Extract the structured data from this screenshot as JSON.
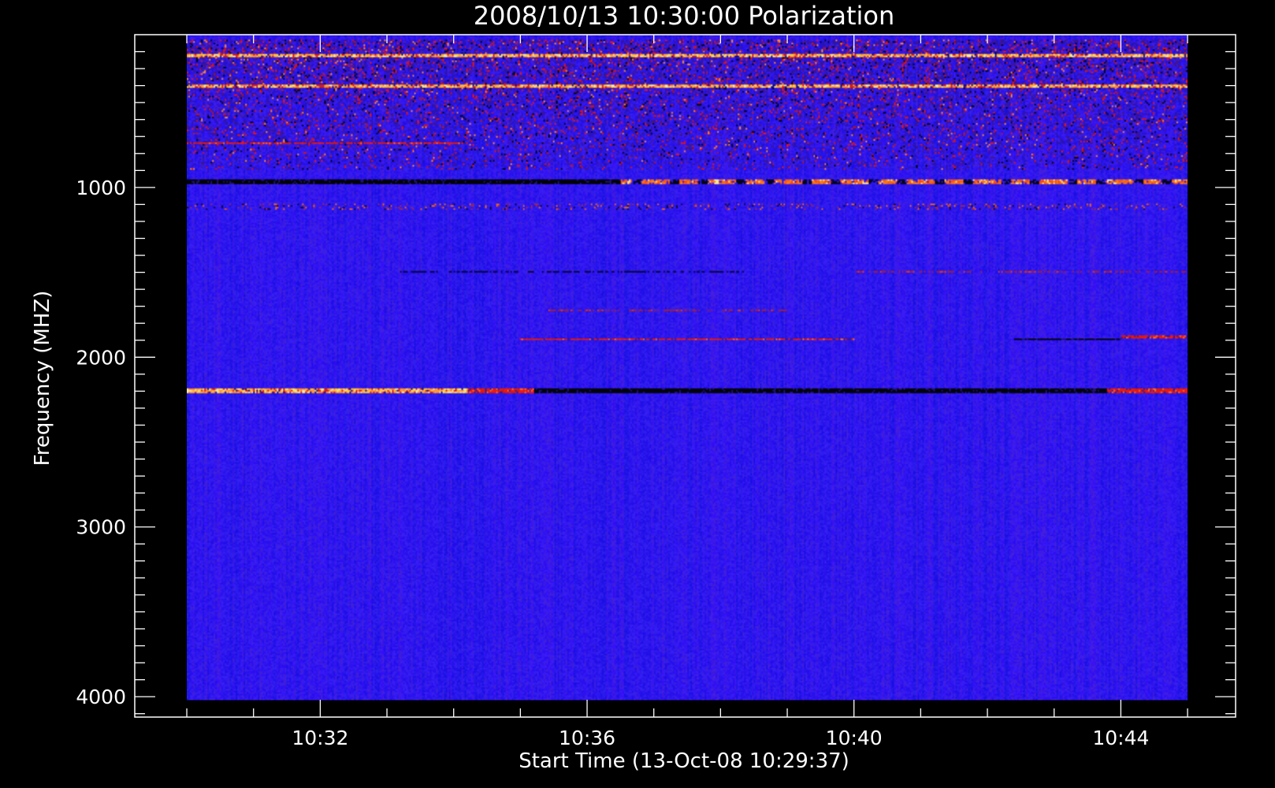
{
  "chart_data": {
    "type": "heatmap",
    "title": "2008/10/13 10:30:00 Polarization",
    "xlabel": "Start Time (13-Oct-08 10:29:37)",
    "ylabel": "Frequency (MHZ)",
    "x_ticks": [
      "10:32",
      "10:36",
      "10:40",
      "10:44"
    ],
    "y_ticks": [
      "1000",
      "2000",
      "3000",
      "4000"
    ],
    "x_tick_minutes": [
      2,
      6,
      10,
      14
    ],
    "y_tick_values": [
      1000,
      2000,
      3000,
      4000
    ],
    "xlim_minutes": [
      -0.78,
      15.72
    ],
    "ylim": [
      100,
      4120
    ],
    "data_extent": {
      "t_start_min": 0,
      "t_end_min": 15,
      "f_min": 100,
      "f_max": 4020
    },
    "y_inverted": true,
    "grid": false,
    "colors": {
      "background": "#000000",
      "base": "#1a14f0",
      "base_dark": "#0a08b8",
      "positive": "#d01808",
      "positive_strong": "#ff7a28",
      "saturated": "#ffe890",
      "negative": "#000000"
    },
    "features": [
      {
        "type": "noise",
        "f_from": 130,
        "f_to": 900,
        "level": 0.55
      },
      {
        "type": "band",
        "freq": 220,
        "width": 18,
        "t_start": 0,
        "t_end": 15,
        "tone": "hot"
      },
      {
        "type": "band",
        "freq": 405,
        "width": 14,
        "t_start": 0,
        "t_end": 15,
        "tone": "hot"
      },
      {
        "type": "band",
        "freq": 735,
        "width": 10,
        "t_start": 0,
        "t_end": 4.2,
        "tone": "red"
      },
      {
        "type": "band",
        "freq": 965,
        "width": 22,
        "t_start": 0,
        "t_end": 6.5,
        "tone": "black"
      },
      {
        "type": "band",
        "freq": 965,
        "width": 22,
        "t_start": 6.5,
        "t_end": 15,
        "tone": "red-broken"
      },
      {
        "type": "band",
        "freq": 1110,
        "width": 40,
        "t_start": 0,
        "t_end": 15,
        "tone": "speckle"
      },
      {
        "type": "band",
        "freq": 1500,
        "width": 12,
        "t_start": 3.2,
        "t_end": 8.4,
        "tone": "dark"
      },
      {
        "type": "band",
        "freq": 1500,
        "width": 12,
        "t_start": 10.0,
        "t_end": 15,
        "tone": "red-faint"
      },
      {
        "type": "band",
        "freq": 1727,
        "width": 9,
        "t_start": 5.4,
        "t_end": 9.0,
        "tone": "red-faint"
      },
      {
        "type": "band",
        "freq": 1895,
        "width": 16,
        "t_start": 5.0,
        "t_end": 10.0,
        "tone": "red"
      },
      {
        "type": "band",
        "freq": 1895,
        "width": 12,
        "t_start": 12.4,
        "t_end": 14.0,
        "tone": "black"
      },
      {
        "type": "band",
        "freq": 1880,
        "width": 10,
        "t_start": 14.0,
        "t_end": 15,
        "tone": "red"
      },
      {
        "type": "band",
        "freq": 2195,
        "width": 30,
        "t_start": 0,
        "t_end": 4.2,
        "tone": "hot"
      },
      {
        "type": "band",
        "freq": 2195,
        "width": 30,
        "t_start": 4.2,
        "t_end": 5.2,
        "tone": "red"
      },
      {
        "type": "band",
        "freq": 2195,
        "width": 30,
        "t_start": 5.2,
        "t_end": 13.8,
        "tone": "black"
      },
      {
        "type": "band",
        "freq": 2195,
        "width": 30,
        "t_start": 13.8,
        "t_end": 15,
        "tone": "red"
      }
    ]
  }
}
